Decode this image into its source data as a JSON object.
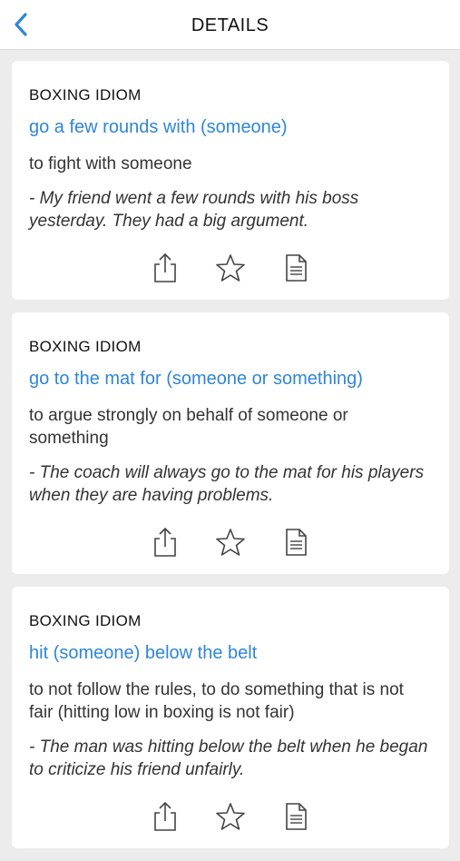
{
  "header": {
    "title": "DETAILS",
    "back_icon": "chevron-left-icon"
  },
  "accent_color": "#2f86d6",
  "cards": [
    {
      "category": "BOXING IDIOM",
      "idiom": "go a few rounds with (someone)",
      "meaning": "to fight with someone",
      "example": "- My friend went a few rounds with his boss yesterday. They had a big argument."
    },
    {
      "category": "BOXING IDIOM",
      "idiom": "go to the mat for (someone or something)",
      "meaning": "to argue strongly on behalf of someone or something",
      "example": "- The coach will always go to the mat for his players when they are having problems."
    },
    {
      "category": "BOXING IDIOM",
      "idiom": "hit (someone) below the belt",
      "meaning": "to not follow the rules, to do something that is not fair (hitting low in boxing is not fair)",
      "example": "- The man was hitting below the belt when he began to criticize his friend unfairly."
    }
  ],
  "actions": [
    "share-icon",
    "star-icon",
    "document-icon"
  ]
}
